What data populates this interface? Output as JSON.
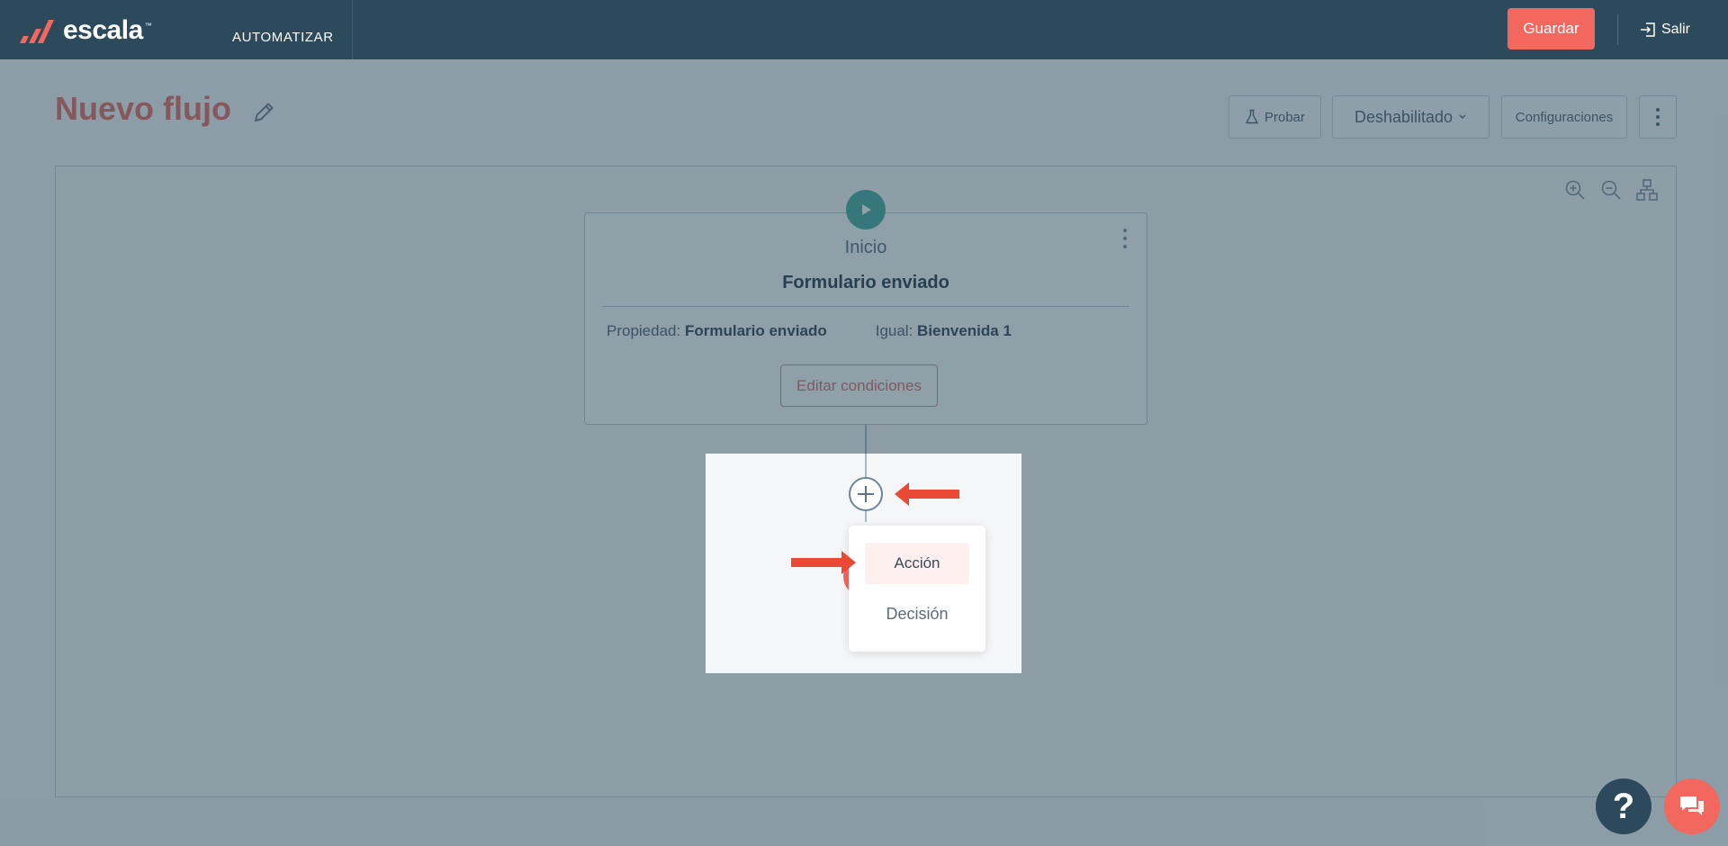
{
  "brand": {
    "name": "escala",
    "tm": "™"
  },
  "nav": {
    "automatizar": "AUTOMATIZAR"
  },
  "topbar": {
    "save_label": "Guardar",
    "exit_label": "Salir"
  },
  "flow": {
    "title": "Nuevo flujo"
  },
  "toolbar": {
    "test_label": "Probar",
    "status_label": "Deshabilitado",
    "settings_label": "Configuraciones"
  },
  "start_node": {
    "kicker": "Inicio",
    "title": "Formulario enviado",
    "condition": {
      "property_label": "Propiedad:",
      "property_value": "Formulario enviado",
      "equals_label": "Igual:",
      "equals_value": "Bienvenida 1"
    },
    "edit_label": "Editar condiciones"
  },
  "add_menu": {
    "items": [
      {
        "label": "Acción"
      },
      {
        "label": "Decisión"
      }
    ]
  },
  "help": {
    "label": "?"
  },
  "colors": {
    "brand_dark": "#2c4a5c",
    "accent": "#f2685e",
    "start_green": "#3fa79d",
    "annotation_arrow": "#ea4a35"
  }
}
